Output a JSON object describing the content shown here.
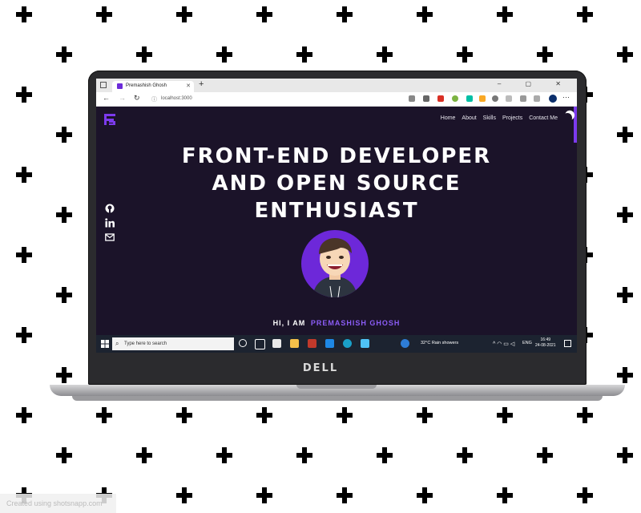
{
  "browser": {
    "tab_title": "Premashish Ghosh",
    "tab_close": "✕",
    "new_tab": "+",
    "address": "localhost:3000",
    "window_controls": "–  ▢  ✕",
    "back": "←",
    "forward": "→",
    "reload": "↻",
    "menu": "⋯"
  },
  "site": {
    "nav": [
      "Home",
      "About",
      "Skills",
      "Projects",
      "Contact Me"
    ],
    "headline_lines": [
      "Front-End Developer",
      "and Open Source",
      "Enthusiast"
    ],
    "greeting": "HI, I AM",
    "name": "PREMASHISH GHOSH",
    "social": [
      "github-icon",
      "linkedin-icon",
      "email-icon"
    ],
    "colors": {
      "background": "#1b1329",
      "accent": "#7c3aed"
    }
  },
  "taskbar": {
    "search_placeholder": "Type here to search",
    "weather": "32°C  Rain showers",
    "lang": "ENG",
    "time": "16:49",
    "date": "24-08-2021"
  },
  "laptop": {
    "brand": "DELL"
  },
  "watermark": "Created using shotsnapp.com"
}
